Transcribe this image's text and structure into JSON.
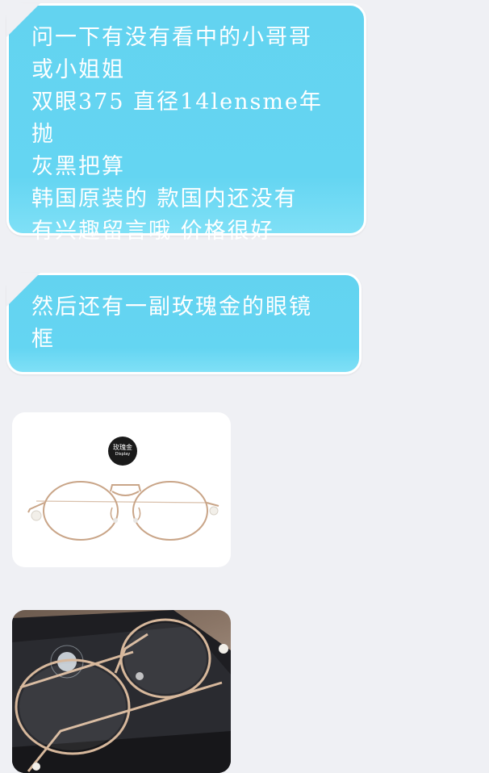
{
  "messages": [
    {
      "type": "text",
      "text": "问一下有没有看中的小哥哥\n或小姐姐\n双眼375 直径14lensme年抛\n 灰黑把算\n韩国原装的 款国内还没有\n有兴趣留言哦 价格很好"
    },
    {
      "type": "text",
      "text": "然后还有一副玫瑰金的眼镜\n框"
    },
    {
      "type": "image",
      "badge_title": "玫瑰金",
      "badge_sub": "Display"
    },
    {
      "type": "image"
    }
  ],
  "colors": {
    "bubble": "#63d3f0",
    "background": "#eff0f4",
    "frame": "#c9a588"
  }
}
